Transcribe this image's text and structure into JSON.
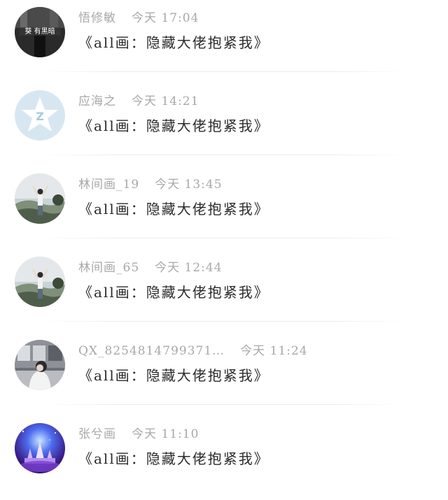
{
  "comments": [
    {
      "username": "悟修敏",
      "time": "今天 17:04",
      "message": "《all画：隐藏大佬抱紧我》",
      "avatar": "dark-photo-avatar",
      "avatar_text": "葵 有黑暗"
    },
    {
      "username": "应海之",
      "time": "今天 14:21",
      "message": "《all画：隐藏大佬抱紧我》",
      "avatar": "qzone-default-avatar"
    },
    {
      "username": "林间画_19",
      "time": "今天 13:45",
      "message": "《all画：隐藏大佬抱紧我》",
      "avatar": "landscape-person-avatar"
    },
    {
      "username": "林间画_65",
      "time": "今天 12:44",
      "message": "《all画：隐藏大佬抱紧我》",
      "avatar": "landscape-person-avatar"
    },
    {
      "username": "QX_8254814799371…",
      "time": "今天 11:24",
      "message": "《all画：隐藏大佬抱紧我》",
      "avatar": "train-girl-avatar"
    },
    {
      "username": "张兮画",
      "time": "今天 11:10",
      "message": "《all画：隐藏大佬抱紧我》",
      "avatar": "fantasy-castle-avatar"
    }
  ]
}
